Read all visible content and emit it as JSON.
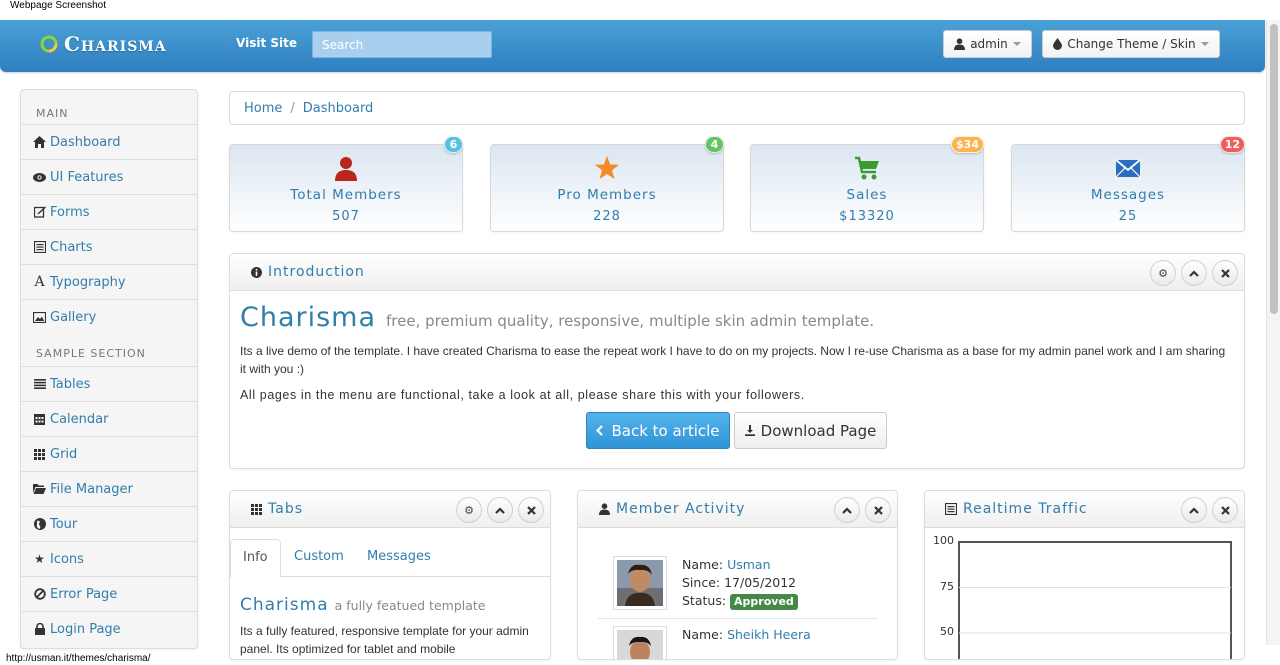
{
  "page_caption": "Webpage Screenshot",
  "status_url": "http://usman.it/themes/charisma/",
  "navbar": {
    "brand": "Charisma",
    "visit_site": "Visit Site",
    "search_placeholder": "Search",
    "user_button": "admin",
    "theme_button": "Change Theme / Skin"
  },
  "sidebar": {
    "main_header": "MAIN",
    "main_items": [
      {
        "label": "Dashboard",
        "icon": "home-icon"
      },
      {
        "label": "UI Features",
        "icon": "eye-icon"
      },
      {
        "label": "Forms",
        "icon": "edit-icon"
      },
      {
        "label": "Charts",
        "icon": "list-alt-icon"
      },
      {
        "label": "Typography",
        "icon": "font-icon"
      },
      {
        "label": "Gallery",
        "icon": "picture-icon"
      }
    ],
    "sample_header": "SAMPLE SECTION",
    "sample_items": [
      {
        "label": "Tables",
        "icon": "align-justify-icon"
      },
      {
        "label": "Calendar",
        "icon": "calendar-icon"
      },
      {
        "label": "Grid",
        "icon": "th-icon"
      },
      {
        "label": "File Manager",
        "icon": "folder-open-icon"
      },
      {
        "label": "Tour",
        "icon": "globe-icon"
      },
      {
        "label": "Icons",
        "icon": "star-icon"
      },
      {
        "label": "Error Page",
        "icon": "ban-circle-icon"
      },
      {
        "label": "Login Page",
        "icon": "lock-icon"
      }
    ]
  },
  "breadcrumb": [
    "Home",
    "Dashboard"
  ],
  "stats": [
    {
      "title": "Total Members",
      "value": "507",
      "badge": "6",
      "badge_color": "#5bc0de",
      "icon": "user-icon"
    },
    {
      "title": "Pro Members",
      "value": "228",
      "badge": "4",
      "badge_color": "#62c462",
      "icon": "star-icon"
    },
    {
      "title": "Sales",
      "value": "$13320",
      "badge": "$34",
      "badge_color": "#fbb450",
      "icon": "cart-icon"
    },
    {
      "title": "Messages",
      "value": "25",
      "badge": "12",
      "badge_color": "#ee5f5b",
      "icon": "envelope-icon"
    }
  ],
  "intro": {
    "title": "Introduction",
    "name": "Charisma",
    "subtitle": "free, premium quality, responsive, multiple skin admin template.",
    "p1": "Its a live demo of the template. I have created Charisma to ease the repeat work I have to do on my projects. Now I re-use Charisma as a base for my admin panel work and I am sharing it with you :)",
    "p2": "All pages in the menu are functional, take a look at all, please share this with your followers.",
    "back_button": "Back to article",
    "download_button": "Download Page"
  },
  "tabs_box": {
    "title": "Tabs",
    "tabs": [
      "Info",
      "Custom",
      "Messages"
    ],
    "active_tab": "Info",
    "heading": "Charisma",
    "heading_sub": "a fully featued template",
    "text": "Its a fully featured, responsive template for your admin panel. Its optimized for tablet and mobile"
  },
  "member_box": {
    "title": "Member Activity",
    "name_label": "Name:",
    "since_label": "Since:",
    "status_label": "Status:",
    "members": [
      {
        "name": "Usman",
        "since": "17/05/2012",
        "status": "Approved"
      },
      {
        "name": "Sheikh Heera"
      }
    ]
  },
  "traffic_box": {
    "title": "Realtime Traffic"
  },
  "chart_data": {
    "type": "line",
    "title": "Realtime Traffic",
    "y_ticks": [
      100,
      75,
      50
    ],
    "ylim": [
      0,
      100
    ],
    "grid": true,
    "series": []
  },
  "colors": {
    "navbar": "#2f7fc0",
    "link": "#317eac",
    "primary_button": "#2f94d6",
    "success_label": "#468847"
  }
}
